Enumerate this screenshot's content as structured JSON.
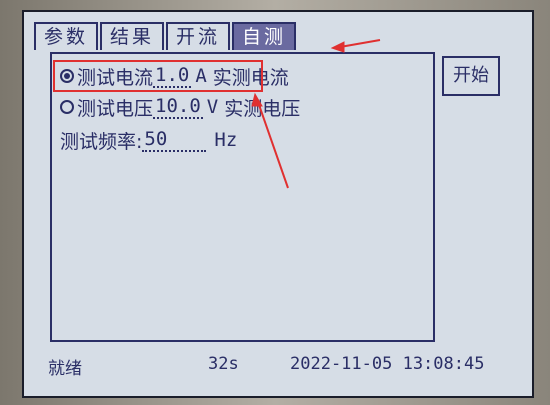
{
  "tabs": [
    {
      "label": "参数",
      "active": false
    },
    {
      "label": "结果",
      "active": false
    },
    {
      "label": "开流",
      "active": false
    },
    {
      "label": "自测",
      "active": true
    }
  ],
  "rows": [
    {
      "label": "测试电流",
      "value": "1.0",
      "unit": "A",
      "measured": "实测电流",
      "selected": true
    },
    {
      "label": "测试电压",
      "value": "10.0",
      "unit": "V",
      "measured": "实测电压",
      "selected": false
    }
  ],
  "frequency": {
    "label": "测试频率:",
    "value": "50",
    "unit": "Hz"
  },
  "start_button": "开始",
  "status": {
    "state": "就绪",
    "timer": "32s",
    "datetime": "2022-11-05  13:08:45"
  },
  "colors": {
    "lcd": "#d6dde6",
    "text": "#2a2e66",
    "annotation": "#e03030"
  }
}
